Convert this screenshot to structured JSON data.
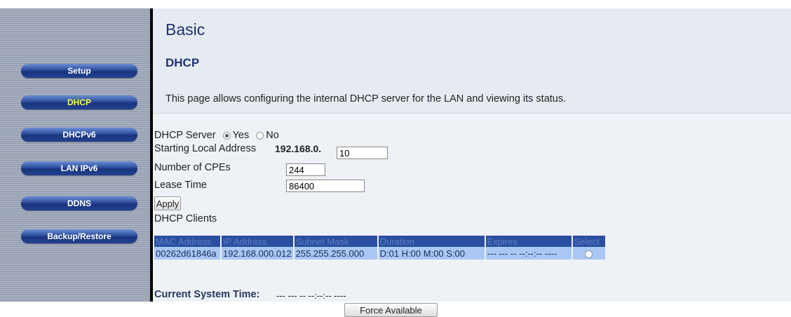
{
  "sidebar": {
    "items": [
      {
        "label": "Setup",
        "active": false
      },
      {
        "label": "DHCP",
        "active": true
      },
      {
        "label": "DHCPv6",
        "active": false
      },
      {
        "label": "LAN IPv6",
        "active": false
      },
      {
        "label": "DDNS",
        "active": false
      },
      {
        "label": "Backup/Restore",
        "active": false
      }
    ]
  },
  "header": {
    "title": "Basic",
    "section": "DHCP",
    "description": "This page allows configuring the internal DHCP server for the LAN and viewing its status."
  },
  "form": {
    "dhcp_server_label": "DHCP Server",
    "yes_label": "Yes",
    "no_label": "No",
    "dhcp_server_value": "Yes",
    "starting_address_label": "Starting Local Address",
    "starting_address_prefix": "192.168.0.",
    "starting_address_value": "10",
    "cpes_label": "Number of CPEs",
    "cpes_value": "244",
    "lease_label": "Lease Time",
    "lease_value": "86400",
    "apply_label": "Apply"
  },
  "clients": {
    "title": "DHCP Clients",
    "columns": [
      "MAC Address",
      "IP Address",
      "Subnet Mask",
      "Duration",
      "Expires",
      "Select"
    ],
    "rows": [
      {
        "mac": "00262d61846a",
        "ip": "192.168.000.012",
        "mask": "255.255.255.000",
        "duration": "D:01 H:00 M:00 S:00",
        "expires": "--- --- -- --:--:-- ----"
      }
    ]
  },
  "system_time": {
    "label": "Current System Time:",
    "value": "--- --- -- --:--:-- ----"
  },
  "force_button_label": "Force Available",
  "colors": {
    "nav_button": "#22428f",
    "nav_active_text": "#f6ff3a",
    "table_header": "#2a4fa0",
    "table_row": "#a9c7f5"
  }
}
